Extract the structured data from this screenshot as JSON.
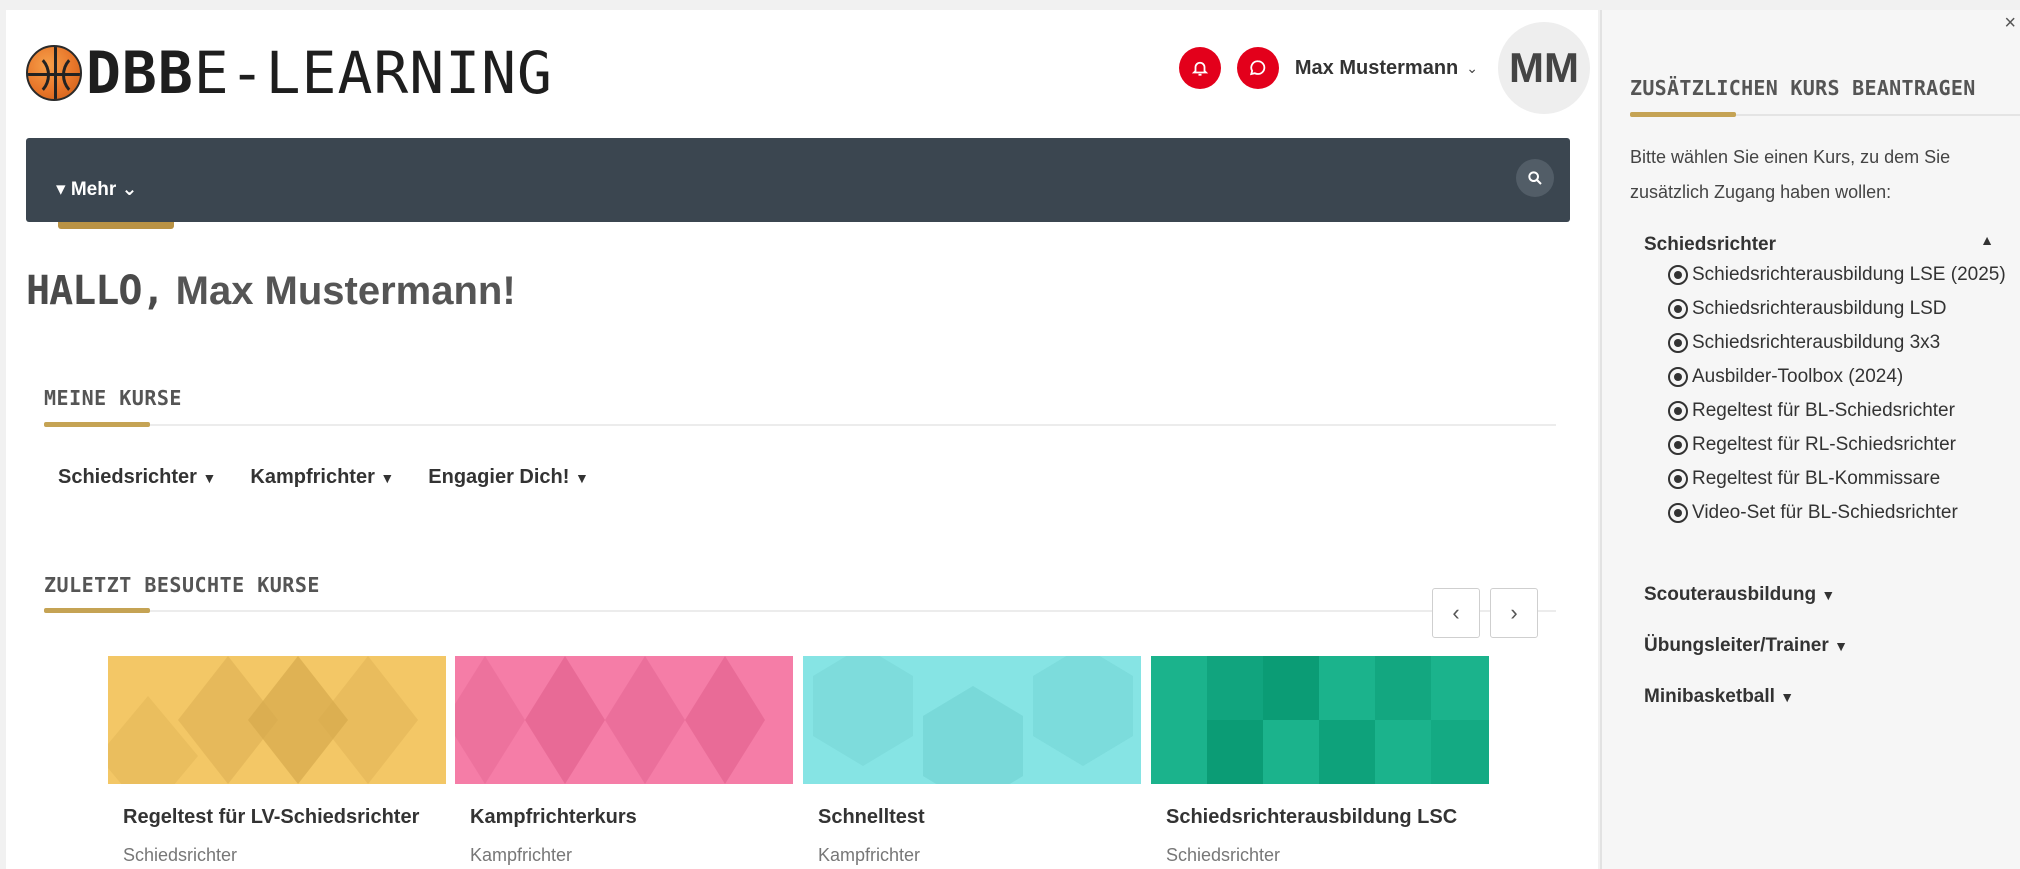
{
  "header": {
    "logo_bold": "DBB",
    "logo_light": "E-LEARNING",
    "user_name": "Max Mustermann",
    "avatar_initials": "MM"
  },
  "nav": {
    "more_label": "Mehr"
  },
  "greeting": {
    "hallo": "HALLO,",
    "name": "Max Mustermann!"
  },
  "my_courses": {
    "title": "MEINE KURSE",
    "tabs": [
      "Schiedsrichter",
      "Kampfrichter",
      "Engagier Dich!"
    ]
  },
  "recent": {
    "title": "ZULETZT BESUCHTE KURSE",
    "cards": [
      {
        "title": "Regeltest für LV-Schiedsrichter",
        "category": "Schiedsrichter",
        "color": "#f3c766",
        "shade": "#d6a94d"
      },
      {
        "title": "Kampfrichterkurs",
        "category": "Kampfrichter",
        "color": "#f57da7",
        "shade": "#e2628f"
      },
      {
        "title": "Schnelltest",
        "category": "Kampfrichter",
        "color": "#86e4e4",
        "shade": "#6fcfcf"
      },
      {
        "title": "Schiedsrichterausbildung LSC",
        "category": "Schiedsrichter",
        "color": "#1bb38c",
        "shade": "#07966f"
      }
    ]
  },
  "drawer": {
    "title": "ZUSÄTZLICHEN KURS BEANTRAGEN",
    "intro": "Bitte wählen Sie einen Kurs, zu dem Sie zusätzlich Zugang haben wollen:",
    "groups": [
      {
        "label": "Schiedsrichter",
        "courses": [
          "Schiedsrichterausbildung LSE (2025)",
          "Schiedsrichterausbildung LSD",
          "Schiedsrichterausbildung 3x3",
          "Ausbilder-Toolbox (2024)",
          "Regeltest für BL-Schiedsrichter",
          "Regeltest für RL-Schiedsrichter",
          "Regeltest für BL-Kommissare",
          "Video-Set für BL-Schiedsrichter"
        ]
      },
      {
        "label": "Scouterausbildung"
      },
      {
        "label": "Übungsleiter/Trainer"
      },
      {
        "label": "Minibasketball"
      }
    ]
  }
}
